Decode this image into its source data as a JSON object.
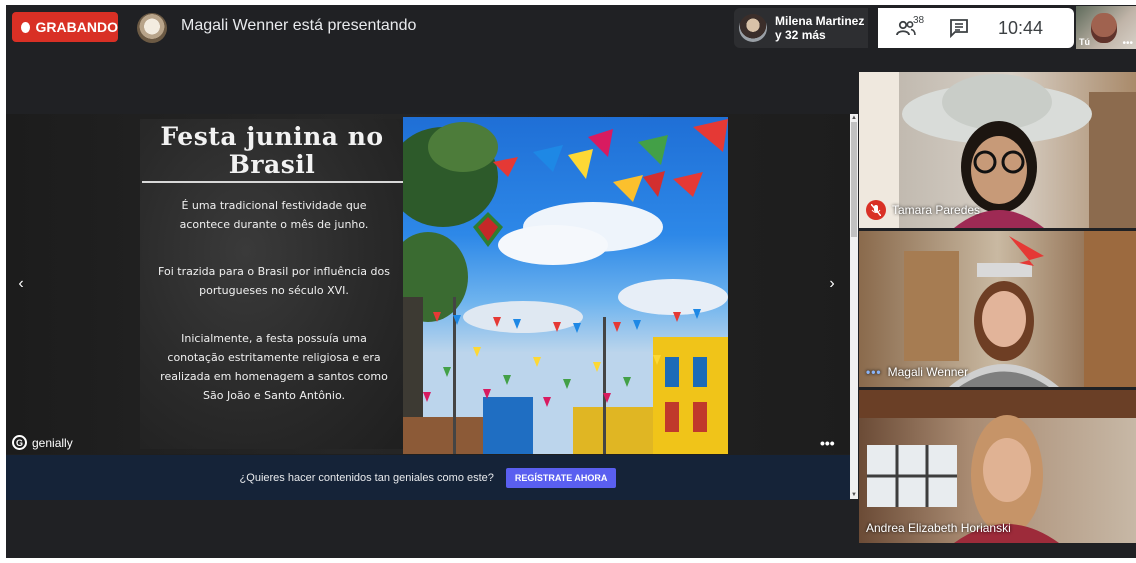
{
  "recording": {
    "label": "GRABANDO",
    "color": "#d93025"
  },
  "presenting": {
    "text": "Magali Wenner está presentando"
  },
  "viewers": {
    "line1": "Milena Martinez",
    "line2": "y 32 más"
  },
  "controls": {
    "participant_count": "38",
    "time": "10:44"
  },
  "self_view": {
    "label": "Tú"
  },
  "slide": {
    "title_line1": "Festa junina no",
    "title_line2": "Brasil",
    "paragraph1": "É uma tradicional festividade que acontece durante o mês de junho.",
    "paragraph2": "Foi trazida para o Brasil por influência dos portugueses no século XVI.",
    "paragraph3": "Inicialmente, a festa possuía uma conotação estritamente religiosa e era realizada em homenagem a santos como São João e Santo Antônio."
  },
  "player": {
    "brand": "genially",
    "promo_question": "¿Quieres hacer contenidos tan geniales como este?",
    "promo_cta": "REGÍSTRATE AHORA"
  },
  "participants": [
    {
      "name": "Tamara Paredes",
      "muted": true
    },
    {
      "name": "Magali Wenner",
      "muted": false
    },
    {
      "name": "Andrea Elizabeth Horianski",
      "muted": false
    }
  ]
}
